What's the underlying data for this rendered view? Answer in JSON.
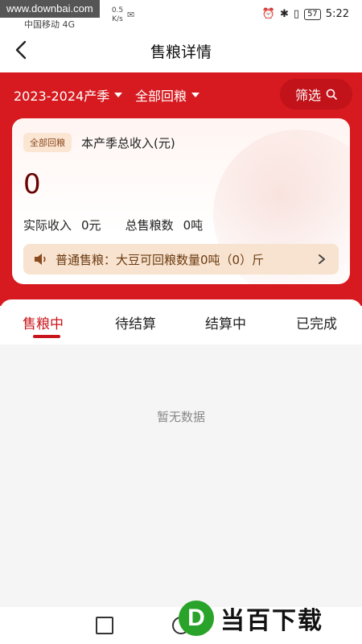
{
  "status": {
    "watermark": "www.downbai.com",
    "carrier": "中国移动 4G",
    "netspeed_value": "0.5",
    "netspeed_unit": "K/s",
    "battery": "57",
    "time": "5:22"
  },
  "nav": {
    "title": "售粮详情"
  },
  "filters": {
    "season": "2023-2024产季",
    "grain": "全部回粮",
    "screen_label": "筛选"
  },
  "summary": {
    "tag": "全部回粮",
    "label": "本产季总收入(元)",
    "amount": "0",
    "actual_label": "实际收入",
    "actual_value": "0元",
    "total_label": "总售粮数",
    "total_value": "0吨",
    "notice": "普通售粮：大豆可回粮数量0吨（0）斤"
  },
  "tabs": [
    "售粮中",
    "待结算",
    "结算中",
    "已完成"
  ],
  "active_tab_index": 0,
  "empty_text": "暂无数据",
  "logo": {
    "badge": "D",
    "text": "当百下载"
  },
  "colors": {
    "primary": "#d61a1f",
    "active": "#c8151b",
    "notice_bg": "#f7e3cf"
  }
}
